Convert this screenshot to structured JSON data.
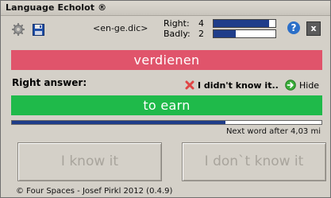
{
  "window": {
    "title": "Language Echolot ®"
  },
  "toolbar": {
    "settings_icon": "gear-icon",
    "save_icon": "floppy-disk-icon",
    "dictionary_file": "<en-ge.dic>"
  },
  "stats": {
    "right_label": "Right:",
    "right_count": "4",
    "right_fraction": 0.9,
    "badly_label": "Badly:",
    "badly_count": "2",
    "badly_fraction": 0.36
  },
  "controls": {
    "help_label": "?",
    "close_label": "x"
  },
  "quiz": {
    "word": "verdienen",
    "answer_heading": "Right answer:",
    "didnt_know_label": "I didn't know it..",
    "hide_label": "Hide",
    "answer": "to earn",
    "timer_progress": 0.69,
    "next_word_text": "Next word after 4,03 mi"
  },
  "buttons": {
    "know_it": "I know it",
    "dont_know_it": "I don`t know it"
  },
  "footer": {
    "copyright": "© Four Spaces - Josef Pirkl 2012 (0.4.9)"
  },
  "colors": {
    "word_bg": "#e0546b",
    "answer_bg": "#1fba4a",
    "bar_fill": "#1f3d8a",
    "window_bg": "#d4d0c8"
  }
}
